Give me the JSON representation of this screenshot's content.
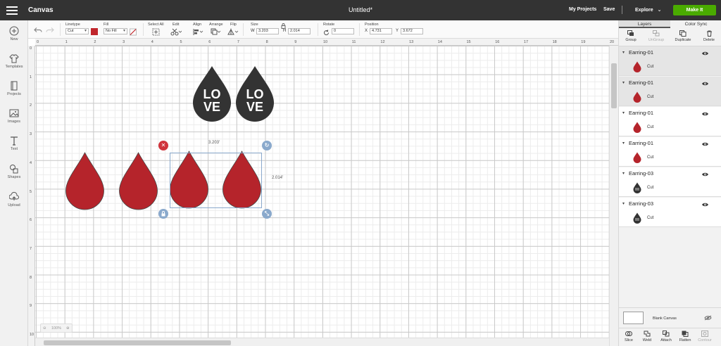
{
  "header": {
    "app_title": "Canvas",
    "doc_title": "Untitled*",
    "my_projects": "My Projects",
    "save": "Save",
    "explore": "Explore",
    "make_it": "Make It",
    "make_it_color": "#4aab00"
  },
  "left_nav": [
    {
      "label": "New",
      "icon": "plus-circle-icon"
    },
    {
      "label": "Templates",
      "icon": "shirt-icon"
    },
    {
      "label": "Projects",
      "icon": "book-icon"
    },
    {
      "label": "Images",
      "icon": "image-icon"
    },
    {
      "label": "Text",
      "icon": "text-t-icon"
    },
    {
      "label": "Shapes",
      "icon": "shapes-icon"
    },
    {
      "label": "Upload",
      "icon": "upload-cloud-icon"
    }
  ],
  "toolbar": {
    "linetype_label": "Linetype",
    "linetype_value": "Cut",
    "fill_label": "Fill",
    "fill_value": "No Fill",
    "swatch_color": "#c0262c",
    "select_all": "Select All",
    "edit": "Edit",
    "align": "Align",
    "arrange": "Arrange",
    "flip": "Flip",
    "size": "Size",
    "w_label": "W",
    "w_value": "3.203",
    "h_label": "H",
    "h_value": "2.014",
    "rotate": "Rotate",
    "rotate_value": "0",
    "position": "Position",
    "x_label": "X",
    "x_value": "4.731",
    "y_label": "Y",
    "y_value": "3.672"
  },
  "canvas": {
    "ruler_top": [
      "0",
      "1",
      "2",
      "3",
      "4",
      "5",
      "6",
      "7",
      "8",
      "9",
      "10",
      "11",
      "12",
      "13",
      "14",
      "15",
      "16",
      "17",
      "18",
      "19",
      "20"
    ],
    "ruler_left": [
      "0",
      "1",
      "2",
      "3",
      "4",
      "5",
      "6",
      "7",
      "8",
      "9",
      "10"
    ],
    "width_label": "3.203'",
    "height_label": "2.014'",
    "zoom": "100%",
    "drop_color": "#b5242b",
    "love_color": "#333333",
    "love_line1": "LO",
    "love_line2": "VE"
  },
  "panel": {
    "tab_layers": "Layers",
    "tab_color_sync": "Color Sync",
    "actions": [
      {
        "label": "Group",
        "enabled": true
      },
      {
        "label": "UnGroup",
        "enabled": false
      },
      {
        "label": "Duplicate",
        "enabled": true
      },
      {
        "label": "Delete",
        "enabled": true
      }
    ],
    "layers": [
      {
        "name": "Earring-01",
        "op": "Cut",
        "kind": "drop",
        "selected": true
      },
      {
        "name": "Earring-01",
        "op": "Cut",
        "kind": "drop",
        "selected": true
      },
      {
        "name": "Earring-01",
        "op": "Cut",
        "kind": "drop",
        "selected": false
      },
      {
        "name": "Earring-01",
        "op": "Cut",
        "kind": "drop",
        "selected": false
      },
      {
        "name": "Earring-03",
        "op": "Cut",
        "kind": "love",
        "selected": false
      },
      {
        "name": "Earring-03",
        "op": "Cut",
        "kind": "love",
        "selected": false
      }
    ],
    "blank_canvas": "Blank Canvas",
    "bottom_tools": [
      {
        "label": "Slice",
        "enabled": true
      },
      {
        "label": "Weld",
        "enabled": true
      },
      {
        "label": "Attach",
        "enabled": true
      },
      {
        "label": "Flatten",
        "enabled": true
      },
      {
        "label": "Contour",
        "enabled": false
      }
    ]
  }
}
